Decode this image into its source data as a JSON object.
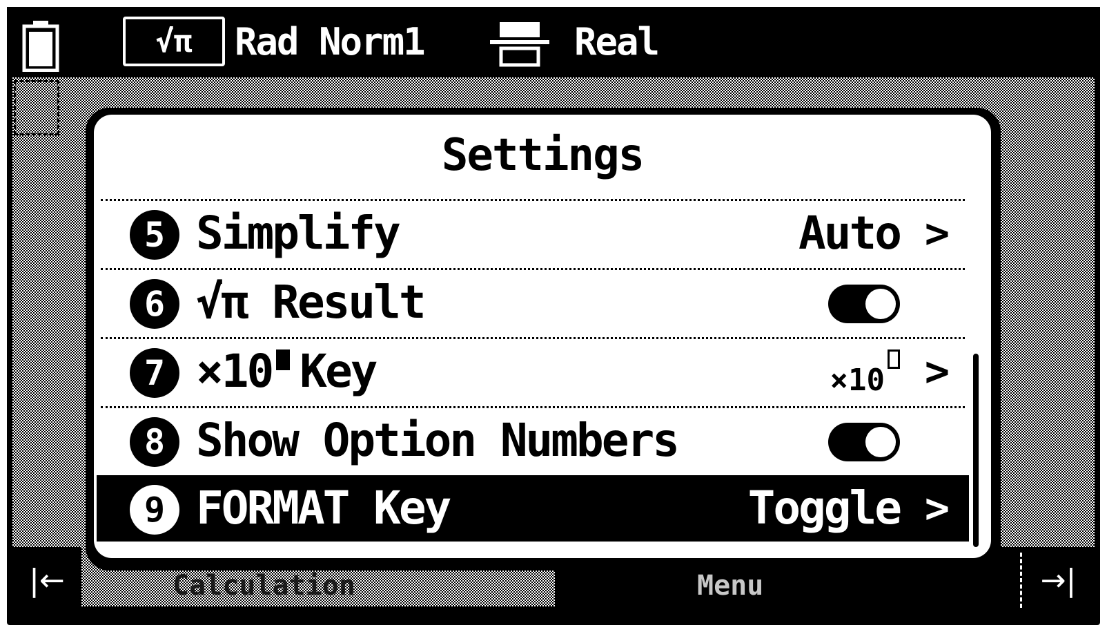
{
  "status_bar": {
    "battery_icon": "battery-full-icon",
    "exact_mode_label": "√π",
    "mode_text": "Rad Norm1",
    "format_icon": "fraction-format-icon",
    "number_mode": "Real"
  },
  "softkeys": {
    "left_icon": "back-arrow-icon",
    "left_glyph": "|←",
    "left_ghost_label": "Calculation",
    "right_ghost_label": "Menu",
    "right_icon": "forward-arrow-icon",
    "right_glyph": "→|"
  },
  "dialog": {
    "title": "Settings",
    "items": [
      {
        "number": "5",
        "label": "Simplify",
        "value": "Auto",
        "type": "select",
        "chevron": ">"
      },
      {
        "number": "6",
        "label": "√π Result",
        "type": "toggle",
        "on": true
      },
      {
        "number": "7",
        "label_prefix": "×10",
        "label_suffix": "Key",
        "value_prefix": "×10",
        "type": "select",
        "chevron": ">"
      },
      {
        "number": "8",
        "label": "Show Option Numbers",
        "type": "toggle",
        "on": true
      },
      {
        "number": "9",
        "label": "FORMAT Key",
        "value": "Toggle",
        "type": "select",
        "chevron": ">",
        "selected": true
      }
    ]
  },
  "colors": {
    "foreground": "#000000",
    "background": "#ffffff"
  }
}
